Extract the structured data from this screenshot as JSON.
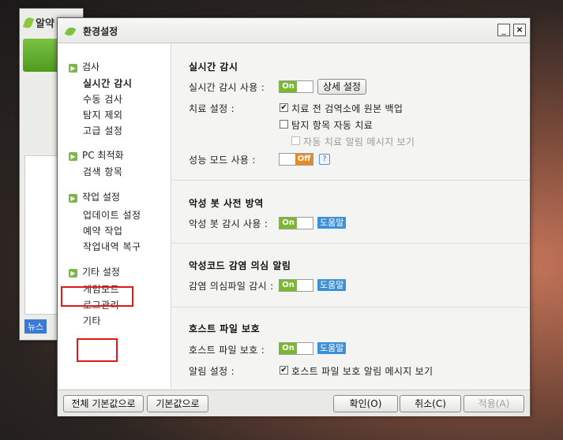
{
  "background_app": {
    "title": "알약",
    "news_label": "뉴스",
    "extra": "C"
  },
  "window": {
    "title": "환경설정",
    "min_label": "_",
    "close_label": "×"
  },
  "sidebar": {
    "categories": [
      {
        "label": "검사",
        "items": [
          "실시간 감시",
          "수동 검사",
          "탐지 제외",
          "고급 설정"
        ]
      },
      {
        "label": "PC 최적화",
        "items": [
          "검색 항목"
        ]
      },
      {
        "label": "작업 설정",
        "items": [
          "업데이트 설정",
          "예약 작업",
          "작업내역 복구"
        ]
      },
      {
        "label": "기타 설정",
        "items": [
          "게임모드",
          "로그관리",
          "기타"
        ]
      }
    ],
    "active_item": "실시간 감시"
  },
  "realtime": {
    "title": "실시간 감시",
    "use_label": "실시간 감시 사용 :",
    "use_toggle": "On",
    "detail_button": "상세 설정",
    "treat_label": "치료 설정 :",
    "backup_label": "치료 전 검역소에 원본 백업",
    "backup_checked": true,
    "auto_treat_label": "탐지 항목 자동 치료",
    "auto_treat_checked": false,
    "auto_msg_label": "자동 치료 알림 메시지 보기",
    "auto_msg_checked": false,
    "perf_label": "성능 모드 사용 :",
    "perf_toggle": "Off",
    "perf_help": "?"
  },
  "bot": {
    "title": "악성 봇 사전 방역",
    "use_label": "악성 봇 감시 사용 :",
    "toggle": "On",
    "help": "도움말"
  },
  "malcode": {
    "title": "악성코드 감염 의심 알림",
    "use_label": "감염 의심파일 감시 :",
    "toggle": "On",
    "help": "도움말"
  },
  "hosts": {
    "title": "호스트 파일 보호",
    "use_label": "호스트 파일 보호 :",
    "toggle": "On",
    "help": "도움말",
    "alert_label": "알림 설정 :",
    "alert_msg_label": "호스트 파일 보호 알림 메시지 보기",
    "alert_checked": true
  },
  "footer": {
    "reset_all": "전체 기본값으로",
    "reset": "기본값으로",
    "ok": "확인(O)",
    "cancel": "취소(C)",
    "apply": "적용(A)"
  },
  "colors": {
    "toggle_on": "#7ab82e",
    "toggle_off": "#e88a20",
    "help_badge": "#3d8fd6",
    "highlight_box": "#e01818"
  }
}
